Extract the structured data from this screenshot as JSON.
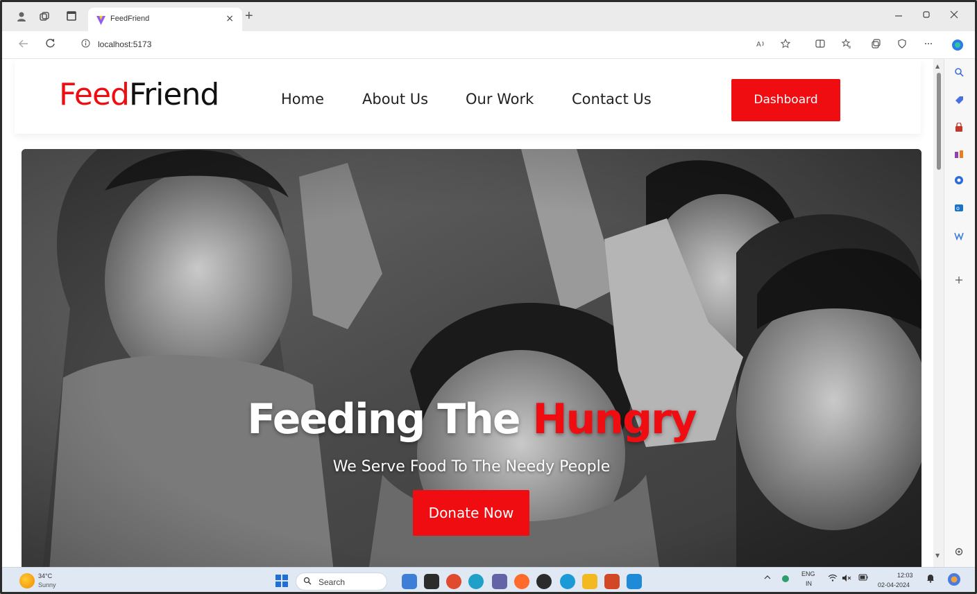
{
  "browser": {
    "tab_title": "FeedFriend",
    "url": "localhost:5173",
    "new_tab_glyph": "+",
    "close_glyph": "×"
  },
  "site": {
    "logo_red": "Feed",
    "logo_dark": "Friend",
    "nav": [
      "Home",
      "About Us",
      "Our Work",
      "Contact Us"
    ],
    "dashboard_label": "Dashboard",
    "hero_title_white": "Feeding The ",
    "hero_title_red": "Hungry",
    "hero_subtitle": "We Serve Food To The Needy People",
    "donate_label": "Donate Now"
  },
  "taskbar": {
    "temperature": "34°C",
    "condition": "Sunny",
    "search_label": "Search",
    "language": "ENG",
    "region": "IN",
    "time": "12:03",
    "date": "02-04-2024"
  },
  "colors": {
    "brand_red": "#ef0d12",
    "nav_text": "#222222",
    "taskbar_bg": "#dfe8f3"
  }
}
